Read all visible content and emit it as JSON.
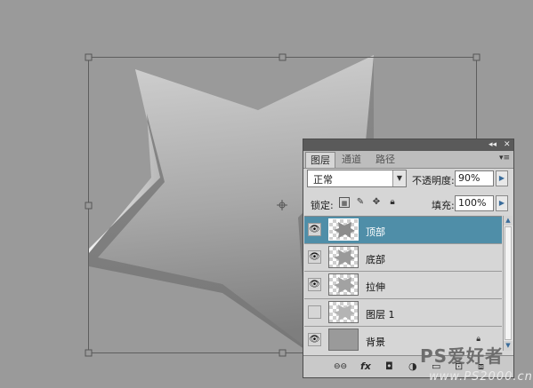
{
  "panel": {
    "topbar": {
      "collapse": "◂◂",
      "close": "✕"
    },
    "tabs": [
      {
        "label": "图层"
      },
      {
        "label": "通道"
      },
      {
        "label": "路径"
      }
    ],
    "menu_icon": "▾≡",
    "blend_mode": "正常",
    "opacity_label": "不透明度:",
    "opacity_value": "90%",
    "lock_label": "锁定:",
    "fill_label": "填充:",
    "fill_value": "100%",
    "layers": [
      {
        "name": "顶部",
        "visible": true,
        "selected": true
      },
      {
        "name": "底部",
        "visible": true,
        "selected": false
      },
      {
        "name": "拉伸",
        "visible": true,
        "selected": false
      },
      {
        "name": "图层 1",
        "visible": false,
        "selected": false
      },
      {
        "name": "背景",
        "visible": true,
        "selected": false,
        "locked": true
      }
    ]
  },
  "bottom_bar": {
    "link": "⊖⊖",
    "fx": "fx",
    "mask": "◘",
    "adjust": "◑",
    "group": "▭",
    "new": "⊡",
    "delete": "⧈"
  },
  "watermark": {
    "line1": "PS爱好者",
    "line2": "www.PS2000.cn"
  },
  "colors": {
    "selected_row": "#4f8ea8",
    "canvas_bg": "#9a9a9a"
  }
}
